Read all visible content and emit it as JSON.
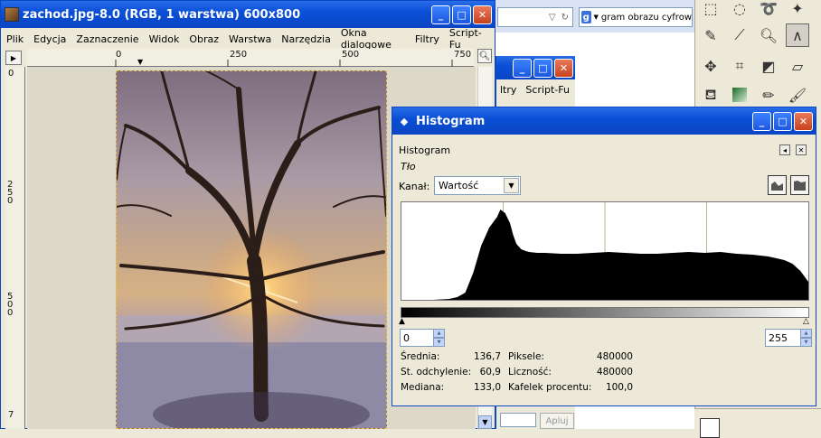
{
  "browser": {
    "search_text": "gram obrazu cyfrow",
    "search_logo": "g"
  },
  "mid_window": {
    "menu": [
      "ltry",
      "Script-Fu"
    ],
    "apply_label": "Apluj"
  },
  "image_window": {
    "title": "zachod.jpg-8.0 (RGB, 1 warstwa) 600x800",
    "menu": [
      "Plik",
      "Edycja",
      "Zaznaczenie",
      "Widok",
      "Obraz",
      "Warstwa",
      "Narzędzia",
      "Okna dialogowe",
      "Filtry",
      "Script-Fu"
    ],
    "hruler_ticks": [
      "0",
      "250",
      "500",
      "750"
    ],
    "vruler_ticks": [
      "0",
      "250",
      "500",
      "7"
    ]
  },
  "histogram": {
    "window_title": "Histogram",
    "header": "Histogram",
    "layer_name": "Tło",
    "channel_label": "Kanał:",
    "channel_value": "Wartość",
    "range_min": "0",
    "range_max": "255",
    "stats": {
      "mean_label": "Średnia:",
      "mean_value": "136,7",
      "std_label": "St. odchylenie:",
      "std_value": "60,9",
      "median_label": "Mediana:",
      "median_value": "133,0",
      "pixels_label": "Piksele:",
      "pixels_value": "480000",
      "count_label": "Liczność:",
      "count_value": "480000",
      "percentile_label": "Kafelek procentu:",
      "percentile_value": "100,0"
    }
  },
  "chart_data": {
    "type": "area",
    "xlim": [
      0,
      255
    ],
    "grid": true,
    "x": [
      0,
      10,
      20,
      30,
      35,
      40,
      45,
      50,
      55,
      60,
      62,
      65,
      68,
      70,
      72,
      75,
      78,
      80,
      85,
      90,
      100,
      110,
      120,
      130,
      140,
      150,
      160,
      170,
      180,
      190,
      200,
      210,
      220,
      230,
      240,
      245,
      250,
      255
    ],
    "y": [
      0,
      0,
      0,
      1,
      3,
      8,
      30,
      60,
      80,
      92,
      100,
      96,
      85,
      72,
      62,
      56,
      54,
      53,
      52,
      52,
      51,
      51,
      52,
      53,
      52,
      51,
      51,
      52,
      53,
      52,
      53,
      51,
      50,
      48,
      44,
      40,
      32,
      20
    ],
    "ylabel": ""
  }
}
